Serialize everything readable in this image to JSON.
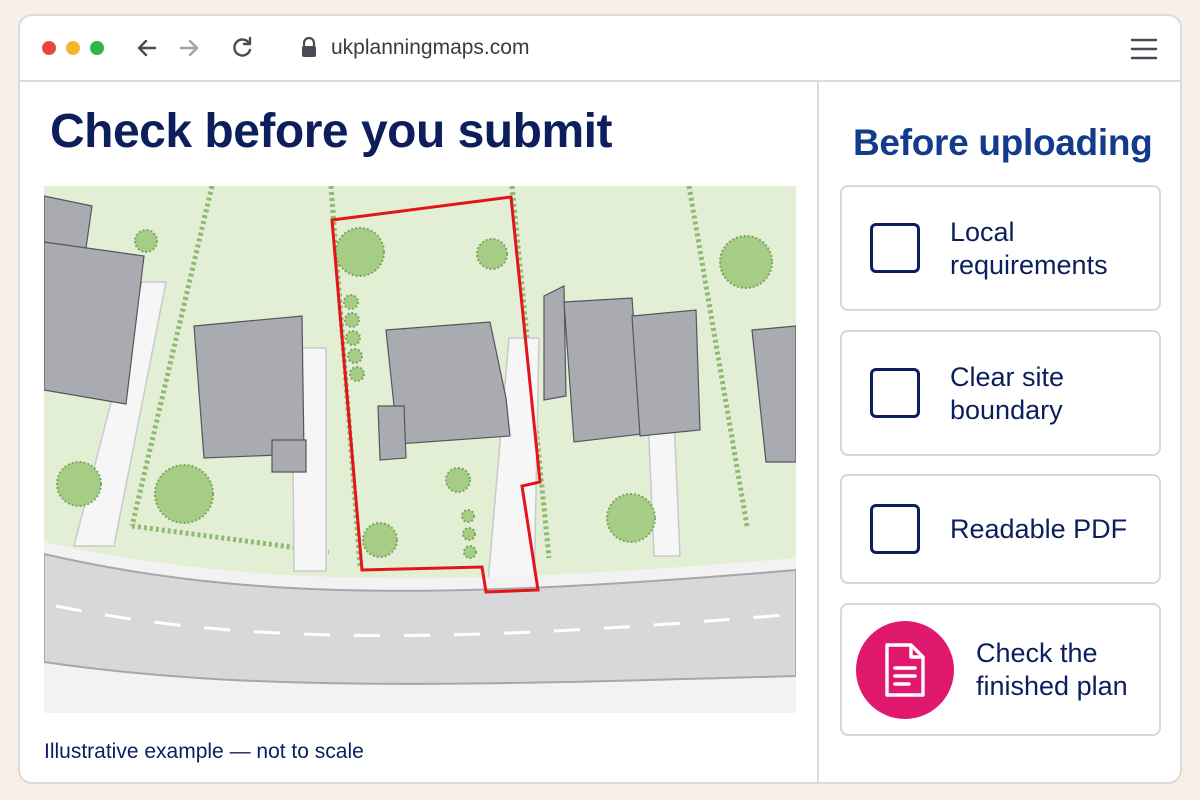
{
  "browser": {
    "url": "ukplanningmaps.com",
    "icons": [
      "back-arrow-icon",
      "forward-arrow-icon",
      "reload-icon",
      "lock-icon",
      "hamburger-menu-icon"
    ]
  },
  "main": {
    "title": "Check before you submit",
    "caption": "Illustrative example — not to scale"
  },
  "sidebar": {
    "title": "Before uploading",
    "items": [
      {
        "label": "Local requirements",
        "checked": false
      },
      {
        "label": "Clear site boundary",
        "checked": false
      },
      {
        "label": "Readable PDF",
        "checked": false
      },
      {
        "label": "Check the finished plan",
        "icon": "document-icon"
      }
    ]
  },
  "colors": {
    "heading": "#0c1f5c",
    "sidebar_heading": "#133b8c",
    "site_boundary": "#e3151a",
    "document_badge": "#e0196e",
    "grass": "#e2efd4",
    "building": "#a9abb1"
  }
}
